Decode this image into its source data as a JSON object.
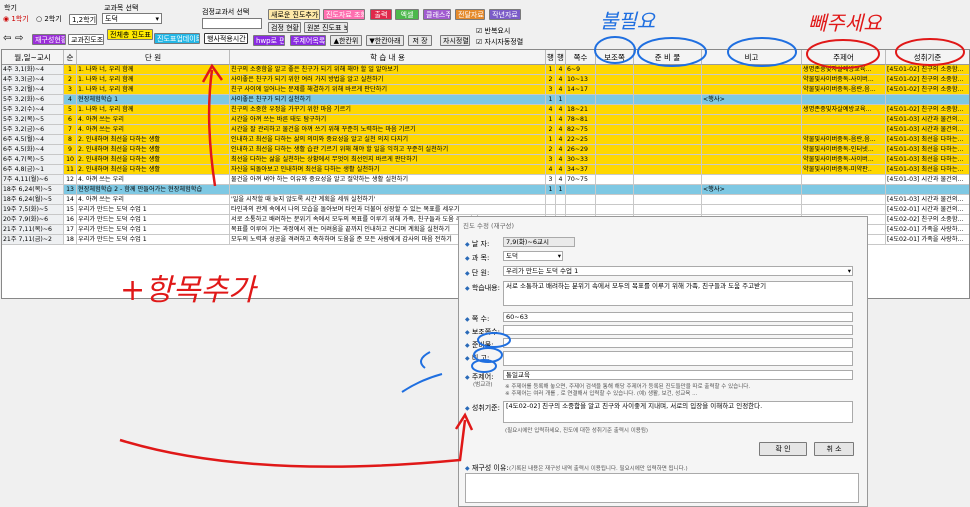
{
  "toolbar": {
    "semester_label": "학기",
    "sem1": "1학기",
    "sem2": "2학기",
    "grade": "1,2학기",
    "subject_label": "교과목 선택",
    "subject_value": "도덕",
    "textbook_label": "검정교과서 선택",
    "btn_new": "새로운 진도추가",
    "btn_ref": "진도자료 조회",
    "btn_print": "출력",
    "btn_excel": "엑셀",
    "btn_class": "클래스주",
    "btn_all": "전달자료",
    "btn_last": "작년자료",
    "btn_status": "검정 현황",
    "btn_view": "원본 진도표 보기",
    "btn_reset": "재구성현황",
    "btn_progress": "교과진도조회",
    "btn_all_prog": "전체총 진도표",
    "btn_inquiry": "진도표업데이트",
    "btn_apply": "행사적용시간",
    "btn_hwp": "hwp로 편집",
    "btn_weekly": "주제어목록",
    "btn_up": "▲한칸위",
    "btn_down": "▼한칸아래",
    "btn_save": "저 장",
    "btn_temp": "자시정렬",
    "chk_a": "반복요시",
    "chk_b": "자시자동정렬"
  },
  "grid": {
    "headers": [
      "월,일~교시",
      "순",
      "단 원",
      "학 습 내 용",
      "행정",
      "행사",
      "쪽수",
      "보조쪽",
      "준 비 물",
      "비고",
      "주제어",
      "성취기준"
    ],
    "rows": [
      {
        "c": [
          "4주 3,1(화)~4",
          "1",
          "1. 나와 너, 우리 함께",
          "친구의 소중함을 알고 좋은 친구가 되기 위해 해야 할 일 알아보기",
          "1",
          "4",
          "6~9",
          "",
          "",
          "",
          "생명존중및자살예방교육...",
          "[4도01-02] 친구의 소중함..."
        ],
        "bg": "#ffd700"
      },
      {
        "c": [
          "4주 3,3(금)~4",
          "2",
          "1. 나와 너, 우리 함께",
          "사이좋은 친구가 되기 위한 여러 가지 방법을 알고 실천하기",
          "2",
          "4",
          "10~13",
          "",
          "",
          "",
          "약물및사이버중독-사이버...",
          "[4도01-02] 친구의 소중함..."
        ],
        "bg": "#ffd700"
      },
      {
        "c": [
          "5주 3,2(월)~4",
          "3",
          "1. 나와 너, 우리 함께",
          "친구 사이에 일어나는 문제를 해결하기 위해 바르게 판단하기",
          "3",
          "4",
          "14~17",
          "",
          "",
          "",
          "약물및사이버중독-음란,음...",
          "[4도01-02] 친구의 소중함..."
        ],
        "bg": "#ffd700"
      },
      {
        "c": [
          "5주 3,2(화)~6",
          "4",
          "현장체험학습 1",
          "사이좋은 친구가 되기 실천하기",
          "1",
          "1",
          "",
          "",
          "",
          "<행사>",
          "",
          ""
        ],
        "bg": "#7ec8e3"
      },
      {
        "c": [
          "5주 3,2(수)~4",
          "5",
          "1. 나와 너, 우리 함께",
          "친구의 소중한 우정을 가꾸기 위한 마음 기르기",
          "4",
          "4",
          "18~21",
          "",
          "",
          "",
          "생명존중및자살예방교육...",
          "[4도01-02] 친구의 소중함..."
        ],
        "bg": "#ffd700"
      },
      {
        "c": [
          "5주 3,2(목)~5",
          "6",
          "4. 아껴 쓰는 우리",
          "시간을 아껴 쓰는 바른 태도 탐구하기",
          "1",
          "4",
          "78~81",
          "",
          "",
          "",
          "",
          "[4도01-03] 시간과 물건의..."
        ],
        "bg": "#ffd700"
      },
      {
        "c": [
          "5주 3,2(금)~6",
          "7",
          "4. 아껴 쓰는 우리",
          "시간을 잘 관리하고 물건을 아껴 쓰기 위해 꾸준히 노력하는 마음 기르기",
          "2",
          "4",
          "82~75",
          "",
          "",
          "",
          "",
          "[4도01-03] 시간과 물건의..."
        ],
        "bg": "#ffd700"
      },
      {
        "c": [
          "6주 4,5(월)~4",
          "8",
          "2. 인내하며 최선을 다하는 생활",
          "인내하고 최선을 다하는 삶의 의미와 중요성을 알고 실천 의지 다지기",
          "1",
          "4",
          "22~25",
          "",
          "",
          "",
          "약물및사이버중독-음란,음...",
          "[4도01-03] 최선을 다하는..."
        ],
        "bg": "#ffd700"
      },
      {
        "c": [
          "6주 4,5(화)~4",
          "9",
          "2. 인내하며 최선을 다하는 생활",
          "인내하고 최선을 다하는 생활 습관 기르기 위해 해야 할 일을 익히고 꾸준히 실천하기",
          "2",
          "4",
          "26~29",
          "",
          "",
          "",
          "약물및사이버중독-인터넷...",
          "[4도01-03] 최선을 다하는..."
        ],
        "bg": "#ffd700"
      },
      {
        "c": [
          "6주 4,7(목)~5",
          "10",
          "2. 인내하며 최선을 다하는 생활",
          "최선을 다하는 삶을 실천하는 상황에서 무엇이 최선인지 바르게 판단하기",
          "3",
          "4",
          "30~33",
          "",
          "",
          "",
          "약물및사이버중독-사이버...",
          "[4도01-03] 최선을 다하는..."
        ],
        "bg": "#ffd700"
      },
      {
        "c": [
          "6주 4,8(금)~1",
          "11",
          "2. 인내하며 최선을 다하는 생활",
          "자신을 되돌아보고 인내하며 최선을 다하는 생활 실천하기",
          "4",
          "4",
          "34~37",
          "",
          "",
          "",
          "약물및사이버중독-미약판..",
          "[4도01-03] 최선을 다하는..."
        ],
        "bg": "#ffd700"
      },
      {
        "c": [
          "7주 4,11(월)~6",
          "12",
          "4. 아껴 쓰는 우리",
          "물건을 아껴 써야 하는 이유와 중요성을 알고 절약하는 생활 실천하기",
          "3",
          "4",
          "70~75",
          "",
          "",
          "",
          "",
          "[4도01-03] 시간과 물건의..."
        ],
        "bg": "#ffffff"
      },
      {
        "c": [
          "18주 6,24(목)~5",
          "13",
          "현장체험학습 2 - 함께 만들어가는 현장체험학습",
          "",
          "1",
          "1",
          "",
          "",
          "",
          "<행사>",
          "",
          ""
        ],
        "bg": "#7ec8e3"
      },
      {
        "c": [
          "18주 6,24(월)~5",
          "14",
          "4. 아껴 쓰는 우리",
          "'일을 시작할 때 늦지 않도록 시간 계획을 세워 실천하기'",
          "",
          "",
          "",
          "",
          "",
          "",
          "",
          "[4도01-03] 시간과 물건의..."
        ],
        "bg": "#ffffff"
      },
      {
        "c": [
          "19주 7,5(화)~5",
          "15",
          "우리가 만드는 도덕 수업 1",
          "타인과의 관계 속에서 나의 모습을 돌아보며 타인과 더불어 성장할 수 있는 목표를 세우기",
          "",
          "",
          "",
          "",
          "",
          "",
          "",
          "[4도02-01] 시간과 물건의..."
        ],
        "bg": "#ffffff"
      },
      {
        "c": [
          "20주 7,9(화)~6",
          "16",
          "우리가 만드는 도덕 수업 1",
          "서로 소통하고 배려하는 분위기 속에서 모두의 목표를 이루기 위해 가족, 친구들과 도움 주고받기",
          "",
          "",
          "",
          "",
          "",
          "",
          "",
          "[4도02-02] 친구의 소중함..."
        ],
        "bg": "#ffffff"
      },
      {
        "c": [
          "21주 7,11(목)~6",
          "17",
          "우리가 만드는 도덕 수업 1",
          "목표를 이루어 가는 과정에서 겪는 어려움을 끝까지 인내하고 견디며 계획을 실천하기",
          "",
          "",
          "",
          "",
          "",
          "",
          "",
          "[4도02-01] 가족을 사랑하..."
        ],
        "bg": "#ffffff"
      },
      {
        "c": [
          "21주 7,11(금)~2",
          "18",
          "우리가 만드는 도덕 수업 1",
          "모두의 노력과 성공을 격려하고 축하하며 도움을 준 모든 사람에게 감사의 마음 전하기",
          "",
          "",
          "",
          "",
          "",
          "",
          "",
          "[4도02-01] 가족을 사랑하..."
        ],
        "bg": "#ffffff"
      }
    ]
  },
  "dialog": {
    "title": "진도 수정 (재구성)",
    "date_label": "날 자:",
    "date_value": "7,9(화)~6교시",
    "subject_label": "과 목:",
    "subject_value": "도덕",
    "unit_label": "단 원:",
    "unit_value": "우리가 만드는 도덕 수업 1",
    "content_label": "학습내용:",
    "content_value": "서로 소통하고 배려하는 분위기 속에서 모두의 목표를 이루기 위해 가족, 친구들과 도움 주고받기",
    "pages_label": "쪽 수:",
    "pages_value": "60~63",
    "aux_label": "보조쪽수:",
    "prep_label": "준비물:",
    "note_label": "비 고:",
    "theme_label": "주제어:",
    "theme_sub": "(범교과)",
    "theme_value": "통일교육",
    "theme_note1": "※ 주제어를 등록해 놓으면, 주제어 검색을 통해 해당 주제어가 등록된 진도들만을 따로 출력할 수 있습니다.",
    "theme_note2": "※ 주제어는 여러 개를 , 로 연결해서 입력할 수 있습니다.  (예) 생활, 보건, 성교육 ...",
    "standard_label": "성취기준:",
    "standard_value": "[4도02-02] 친구의 소중함을 알고 친구와 사이좋게 지내며, 서로의 입장을 이해하고 인정한다.",
    "standard_note": "(필요시에만 입력하세요, 진도에 대한 성취기준 출력시 이용됨)",
    "ok": "확 인",
    "cancel": "취 소",
    "reason_label": "재구성 이유:",
    "reason_hint": "(기록된 내용은 재구성 내역 출력시 이용됩니다. 필요시에만 입력하면 됩니다.)"
  },
  "annotations": {
    "not_needed": "불필요",
    "remove": "빼주세요",
    "add_field": "+항목추가"
  }
}
